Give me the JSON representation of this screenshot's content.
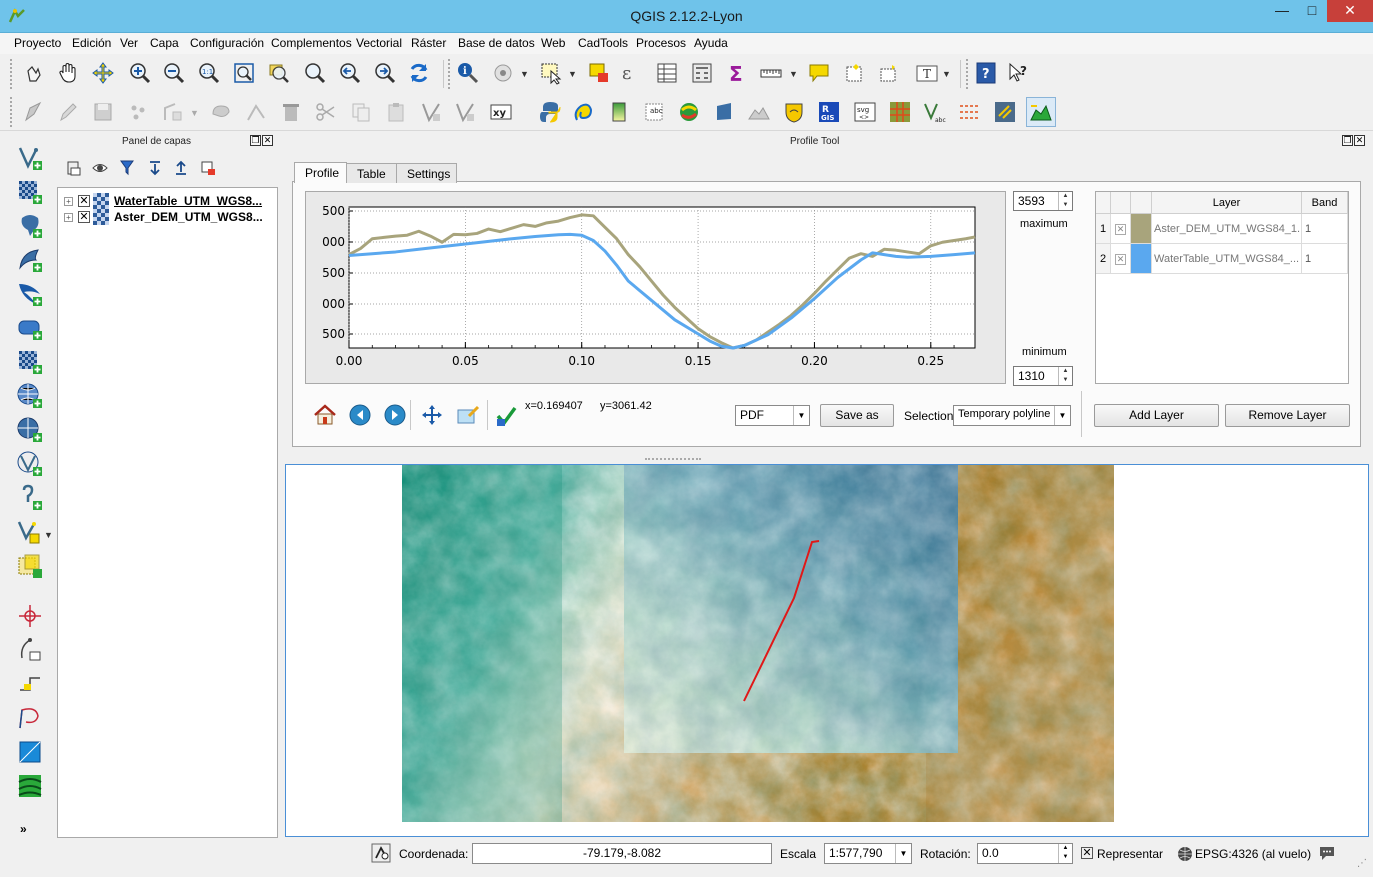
{
  "window": {
    "title": "QGIS 2.12.2-Lyon",
    "minimize": "—",
    "maximize": "□",
    "close": "✕"
  },
  "menu": [
    "Proyecto",
    "Edición",
    "Ver",
    "Capa",
    "Configuración",
    "Complementos",
    "Vectorial",
    "Ráster",
    "Base de datos",
    "Web",
    "CadTools",
    "Procesos",
    "Ayuda"
  ],
  "layers_panel": {
    "title": "Panel de capas",
    "layers": [
      {
        "name": "WaterTable_UTM_WGS8...",
        "checked": true
      },
      {
        "name": "Aster_DEM_UTM_WGS8...",
        "checked": true
      }
    ]
  },
  "profile_tool": {
    "title": "Profile Tool",
    "tabs": [
      "Profile",
      "Table",
      "Settings"
    ],
    "active_tab": "Profile",
    "maximum_label": "maximum",
    "minimum_label": "minimum",
    "maximum_value": "3593",
    "minimum_value": "1310",
    "coords": {
      "x": "x=0.169407",
      "y": "y=3061.42"
    },
    "export_format": "PDF",
    "save_as": "Save as",
    "selection_label": "Selection",
    "selection_value": "Temporary polyline",
    "add_layer": "Add Layer",
    "remove_layer": "Remove Layer",
    "table": {
      "headers": [
        "",
        "",
        "",
        "Layer",
        "Band"
      ],
      "rows": [
        {
          "index": "1",
          "color": "#a8a47c",
          "layer": "Aster_DEM_UTM_WGS84_1...",
          "band": "1"
        },
        {
          "index": "2",
          "color": "#5aa8ef",
          "layer": "WaterTable_UTM_WGS84_...",
          "band": "1"
        }
      ]
    }
  },
  "chart_data": {
    "type": "line",
    "x_ticks": [
      "0.00",
      "0.05",
      "0.10",
      "0.15",
      "0.20",
      "0.25"
    ],
    "y_ticks": [
      "500",
      "000",
      "500",
      "000",
      "500"
    ],
    "xlim": [
      0,
      0.269
    ],
    "series": [
      {
        "color": "#a8a47c",
        "x": [
          0.0,
          0.005,
          0.01,
          0.015,
          0.02,
          0.025,
          0.03,
          0.035,
          0.04,
          0.045,
          0.05,
          0.055,
          0.06,
          0.065,
          0.07,
          0.075,
          0.08,
          0.085,
          0.09,
          0.095,
          0.1,
          0.105,
          0.11,
          0.115,
          0.12,
          0.125,
          0.13,
          0.135,
          0.14,
          0.145,
          0.15,
          0.155,
          0.16,
          0.165,
          0.17,
          0.175,
          0.18,
          0.185,
          0.19,
          0.195,
          0.2,
          0.205,
          0.21,
          0.215,
          0.22,
          0.225,
          0.23,
          0.235,
          0.24,
          0.245,
          0.25,
          0.255,
          0.26,
          0.265,
          0.269
        ],
        "y": [
          3020,
          3090,
          3200,
          3215,
          3230,
          3240,
          3285,
          3230,
          3160,
          3250,
          3245,
          3260,
          3310,
          3280,
          3320,
          3360,
          3340,
          3380,
          3400,
          3440,
          3470,
          3460,
          3330,
          3200,
          3020,
          2880,
          2720,
          2560,
          2420,
          2300,
          2180,
          2090,
          2020,
          1960,
          1990,
          2050,
          2140,
          2230,
          2330,
          2450,
          2580,
          2720,
          2850,
          2980,
          3030,
          3000,
          3080,
          3070,
          3050,
          3030,
          3120,
          3160,
          3180,
          3200,
          3220
        ]
      },
      {
        "color": "#5aa8ef",
        "x": [
          0.0,
          0.01,
          0.02,
          0.03,
          0.04,
          0.05,
          0.06,
          0.07,
          0.08,
          0.09,
          0.095,
          0.1,
          0.105,
          0.11,
          0.115,
          0.12,
          0.13,
          0.14,
          0.15,
          0.155,
          0.16,
          0.165,
          0.17,
          0.18,
          0.19,
          0.2,
          0.21,
          0.22,
          0.225,
          0.23,
          0.235,
          0.24,
          0.25,
          0.26,
          0.269
        ],
        "y": [
          3010,
          3030,
          3050,
          3080,
          3110,
          3140,
          3170,
          3200,
          3225,
          3245,
          3250,
          3240,
          3180,
          3060,
          2900,
          2720,
          2500,
          2280,
          2120,
          2040,
          1980,
          1960,
          1990,
          2110,
          2300,
          2520,
          2760,
          2960,
          3040,
          3020,
          3000,
          2990,
          3000,
          3020,
          3040
        ]
      }
    ]
  },
  "status": {
    "coord_label": "Coordenada:",
    "coord_value": "-79.179,-8.082",
    "scale_label": "Escala",
    "scale_value": "1:577,790",
    "rotation_label": "Rotación:",
    "rotation_value": "0.0",
    "render_label": "Representar",
    "render_checked": true,
    "crs": "EPSG:4326 (al vuelo)"
  },
  "map": {
    "profile_line_color": "#e01818"
  }
}
